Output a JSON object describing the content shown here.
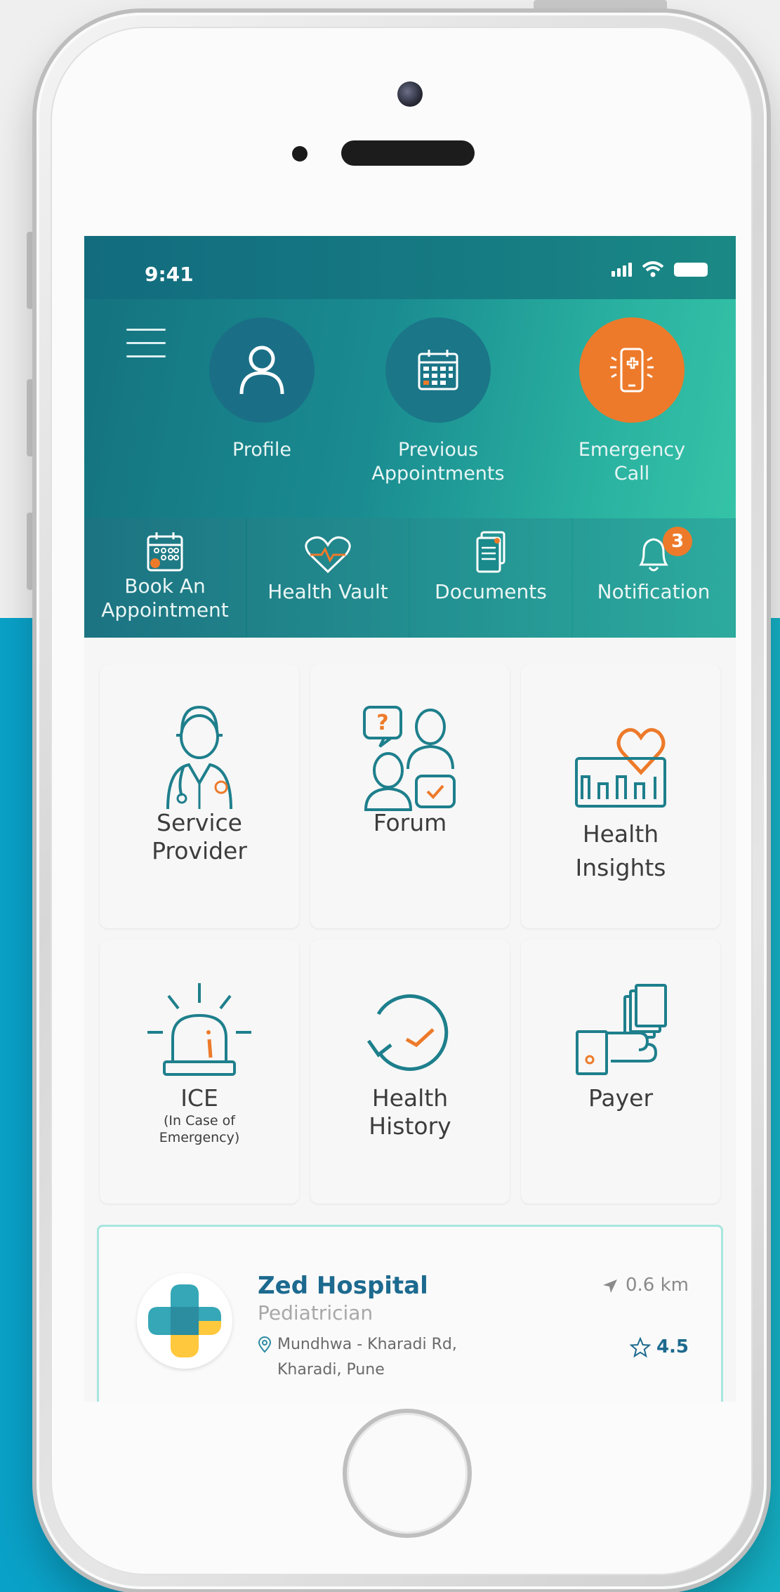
{
  "status_bar": {
    "time": "9:41"
  },
  "header": {
    "profile_label": "Profile",
    "previous_label_line1": "Previous",
    "previous_label_line2": "Appointments",
    "emergency_label_line1": "Emergency",
    "emergency_label_line2": "Call"
  },
  "quick_bar": {
    "book_line1": "Book An",
    "book_line2": "Appointment",
    "health_vault": "Health Vault",
    "documents": "Documents",
    "notification": "Notification",
    "notification_count": "3"
  },
  "tiles": {
    "service_provider_line1": "Service",
    "service_provider_line2": "Provider",
    "forum": "Forum",
    "health_insights_line1": "Health",
    "health_insights_line2": "Insights",
    "ice": "ICE",
    "ice_sub_line1": "(In Case of",
    "ice_sub_line2": "Emergency)",
    "health_history_line1": "Health",
    "health_history_line2": "History",
    "payer": "Payer"
  },
  "hospital_card": {
    "name": "Zed Hospital",
    "specialty": "Pediatrician",
    "address_line1": "Mundhwa - Kharadi Rd,",
    "address_line2": "Kharadi, Pune",
    "distance": "0.6 km",
    "rating": "4.5"
  },
  "colors": {
    "teal": "#1a8c91",
    "orange": "#ed7a2a",
    "icon_stroke": "#1e7f8c",
    "hospital_name": "#1d6a8f"
  }
}
